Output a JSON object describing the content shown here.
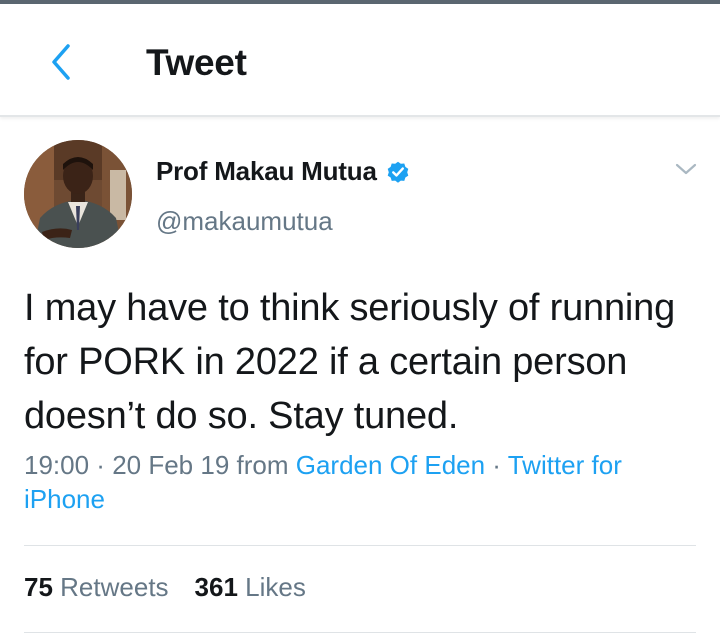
{
  "header": {
    "title": "Tweet",
    "back_icon": "back-chevron-icon"
  },
  "tweet": {
    "author": {
      "display_name": "Prof Makau Mutua",
      "handle": "@makaumutua",
      "verified": true
    },
    "menu_icon": "chevron-down-icon",
    "text": "I may have to think seriously of running for PORK in 2022 if a certain person doesn’t do so.  Stay tuned.",
    "meta": {
      "time": "19:00",
      "separator": " · ",
      "date": "20 Feb 19",
      "from_label": " from ",
      "location": "Garden Of Eden",
      "source": "Twitter for iPhone"
    },
    "stats": {
      "retweets_count": "75",
      "retweets_label": "Retweets",
      "likes_count": "361",
      "likes_label": "Likes"
    }
  },
  "colors": {
    "accent": "#1da1f2",
    "secondary_text": "#657786",
    "primary_text": "#14171a"
  }
}
